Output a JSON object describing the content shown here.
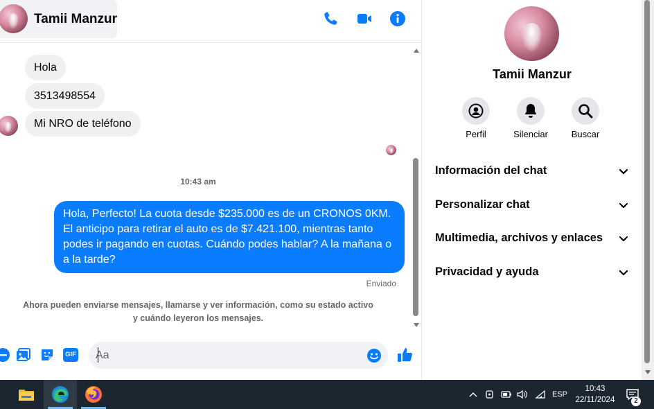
{
  "colors": {
    "accent": "#0a7cff",
    "incoming_bubble": "#f0f0f0",
    "taskbar": "#1c2631"
  },
  "header": {
    "contact_name": "Tamii Manzur",
    "icons": [
      "phone-icon",
      "video-call-icon",
      "info-icon"
    ]
  },
  "messages": {
    "incoming": [
      "Hola",
      "3513498554",
      "Mi NRO de teléfono"
    ],
    "timestamp": "10:43 am",
    "outgoing": "Hola, Perfecto! La cuota desde $235.000 es de un CRONOS 0KM. El anticipo para retirar el auto es de $7.421.100, mientras tanto podes ir pagando en cuotas. Cuándo podes hablar? A la mañana o a la tarde?",
    "status": "Enviado",
    "system_note": "Ahora pueden enviarse mensajes, llamarse y ver información, como su estado activo y cuándo leyeron los mensajes."
  },
  "composer": {
    "placeholder": "Aa",
    "icons": [
      "plus-icon",
      "photo-icon",
      "sticker-icon",
      "gif-icon",
      "emoji-icon",
      "like-icon"
    ],
    "gif_label": "GIF"
  },
  "side": {
    "name": "Tamii Manzur",
    "actions": [
      {
        "label": "Perfil",
        "icon": "profile-icon"
      },
      {
        "label": "Silenciar",
        "icon": "bell-icon"
      },
      {
        "label": "Buscar",
        "icon": "search-icon"
      }
    ],
    "sections": [
      "Información del chat",
      "Personalizar chat",
      "Multimedia, archivos y enlaces",
      "Privacidad y ayuda"
    ]
  },
  "taskbar": {
    "apps": [
      "file-explorer-icon",
      "edge-icon",
      "firefox-icon"
    ],
    "language": "ESP",
    "time": "10:43",
    "date": "22/11/2024",
    "notifications": "2"
  }
}
